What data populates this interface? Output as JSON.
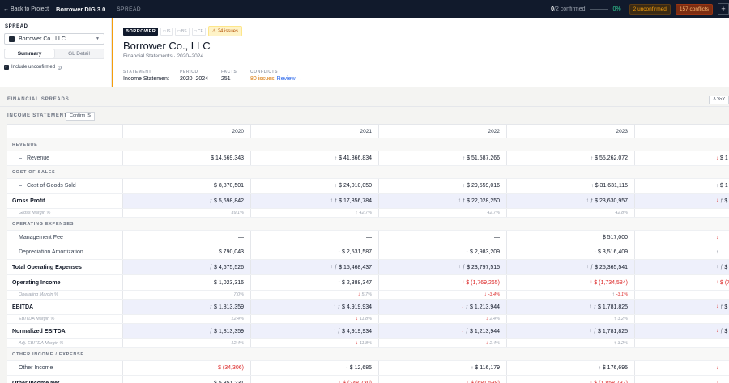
{
  "topbar": {
    "back_label": "← Back to Project",
    "app_title": "Borrower DIG 3.0",
    "tab_label": "SPREAD",
    "confirmed_count": "0",
    "confirmed_text": "/2 confirmed",
    "progress_value": 0,
    "progress_pct": "0%",
    "unconfirmed_badge": "2 unconfirmed",
    "conflicts_badge": "157 conflicts",
    "plus_icon": "+"
  },
  "sidebar": {
    "section_label": "SPREAD",
    "borrower_select": "Borrower Co., LLC",
    "view_tabs": [
      {
        "label": "Summary",
        "active": true
      },
      {
        "label": "GL Detail",
        "active": false
      }
    ],
    "include_unconfirmed_label": "Include unconfirmed",
    "include_unconfirmed_checked": true
  },
  "header": {
    "badge": "BORROWER",
    "statement_chips": [
      "□ IS",
      "□ BS",
      "□ CF"
    ],
    "issues_chip": "⚠ 24 issues",
    "company_name": "Borrower Co., LLC",
    "subtitle": "Financial Statements · 2020–2024",
    "meta": {
      "statement_label": "STATEMENT",
      "statement_value": "Income Statement",
      "period_label": "PERIOD",
      "period_value": "2020–2024",
      "facts_label": "FACTS",
      "facts_value": "251",
      "conflicts_label": "CONFLICTS",
      "conflicts_value": "80 issues",
      "review_link": "Review →"
    }
  },
  "sections": {
    "financial_spreads": "FINANCIAL SPREADS",
    "yoy_button": "Δ YoY",
    "income_statement": "INCOME STATEMENT",
    "confirm_button": "Confirm IS"
  },
  "table": {
    "columns": [
      "",
      "2020",
      "2021",
      "2022",
      "2023",
      ""
    ],
    "rows": [
      {
        "type": "group",
        "label": "REVENUE"
      },
      {
        "type": "line",
        "indent": true,
        "dot": true,
        "label": "Revenue",
        "cells": [
          {
            "v": "$ 14,569,343"
          },
          {
            "v": "$ 41,866,834",
            "m": "up"
          },
          {
            "v": "$ 51,587,266",
            "m": "up"
          },
          {
            "v": "$ 55,262,072",
            "m": "up"
          },
          {
            "v": "$ 1",
            "m": "dn"
          }
        ]
      },
      {
        "type": "group",
        "label": "COST OF SALES"
      },
      {
        "type": "line",
        "indent": true,
        "dot": true,
        "label": "Cost of Goods Sold",
        "cells": [
          {
            "v": "$ 8,870,501"
          },
          {
            "v": "$ 24,010,050",
            "m": "up"
          },
          {
            "v": "$ 29,559,016",
            "m": "up"
          },
          {
            "v": "$ 31,631,115",
            "m": "up"
          },
          {
            "v": "$ 1",
            "m": "up"
          }
        ]
      },
      {
        "type": "total",
        "shaded": true,
        "label": "Gross Profit",
        "cells": [
          {
            "v": "$ 5,698,842",
            "fx": true
          },
          {
            "v": "$ 17,856,784",
            "m": "up",
            "fx": true
          },
          {
            "v": "$ 22,028,250",
            "m": "up",
            "fx": true
          },
          {
            "v": "$ 23,630,957",
            "m": "up",
            "fx": true
          },
          {
            "v": "$ 1",
            "m": "dn",
            "fx": true
          }
        ]
      },
      {
        "type": "sub",
        "label": "Gross Margin %",
        "cells": [
          {
            "v": "39.1%"
          },
          {
            "v": "42.7%",
            "m": "up"
          },
          {
            "v": "42.7%"
          },
          {
            "v": "42.8%"
          },
          {
            "v": ""
          }
        ]
      },
      {
        "type": "group",
        "label": "OPERATING EXPENSES"
      },
      {
        "type": "line",
        "indent": true,
        "label": "Management Fee",
        "cells": [
          {
            "v": "—"
          },
          {
            "v": "—"
          },
          {
            "v": "—"
          },
          {
            "v": "$ 517,000"
          },
          {
            "v": "",
            "m": "dn"
          }
        ]
      },
      {
        "type": "line",
        "indent": true,
        "label": "Depreciation Amortization",
        "cells": [
          {
            "v": "$ 790,043"
          },
          {
            "v": "$ 2,531,587",
            "m": "up"
          },
          {
            "v": "$ 2,983,209",
            "m": "up"
          },
          {
            "v": "$ 3,516,409",
            "m": "up"
          },
          {
            "v": "",
            "m": "up"
          }
        ]
      },
      {
        "type": "total",
        "shaded": true,
        "label": "Total Operating Expenses",
        "cells": [
          {
            "v": "$ 4,675,526",
            "fx": true
          },
          {
            "v": "$ 15,468,437",
            "m": "up",
            "fx": true
          },
          {
            "v": "$ 23,797,515",
            "m": "up",
            "fx": true
          },
          {
            "v": "$ 25,365,541",
            "m": "up",
            "fx": true
          },
          {
            "v": "$ 2",
            "m": "up",
            "fx": true
          }
        ]
      },
      {
        "type": "total",
        "label": "Operating Income",
        "cells": [
          {
            "v": "$ 1,023,316"
          },
          {
            "v": "$ 2,388,347",
            "m": "up"
          },
          {
            "v": "$ (1,769,265)",
            "m": "dn",
            "neg": true
          },
          {
            "v": "$ (1,734,584)",
            "m": "dn",
            "neg": true
          },
          {
            "v": "$ (7",
            "m": "dn",
            "neg": true
          }
        ]
      },
      {
        "type": "sub",
        "label": "Operating Margin %",
        "cells": [
          {
            "v": "7.0%"
          },
          {
            "v": "5.7%",
            "m": "dn"
          },
          {
            "v": "-3.4%",
            "m": "dn",
            "neg": true
          },
          {
            "v": "-3.1%",
            "m": "up",
            "neg": true
          },
          {
            "v": ""
          }
        ]
      },
      {
        "type": "total",
        "shaded": true,
        "label": "EBITDA",
        "cells": [
          {
            "v": "$ 1,813,359",
            "fx": true
          },
          {
            "v": "$ 4,919,934",
            "m": "up",
            "fx": true
          },
          {
            "v": "$ 1,213,944",
            "m": "dn",
            "fx": true
          },
          {
            "v": "$ 1,781,825",
            "m": "up",
            "fx": true
          },
          {
            "v": "$ 1",
            "m": "dn",
            "fx": true
          }
        ]
      },
      {
        "type": "sub",
        "label": "EBITDA Margin %",
        "cells": [
          {
            "v": "12.4%"
          },
          {
            "v": "11.8%",
            "m": "dn"
          },
          {
            "v": "2.4%",
            "m": "dn"
          },
          {
            "v": "3.2%",
            "m": "up"
          },
          {
            "v": ""
          }
        ]
      },
      {
        "type": "total",
        "shaded": true,
        "label": "Normalized EBITDA",
        "cells": [
          {
            "v": "$ 1,813,359",
            "fx": true
          },
          {
            "v": "$ 4,919,934",
            "m": "up",
            "fx": true
          },
          {
            "v": "$ 1,213,944",
            "m": "dn",
            "fx": true
          },
          {
            "v": "$ 1,781,825",
            "m": "up",
            "fx": true
          },
          {
            "v": "$ 1",
            "m": "dn",
            "fx": true
          }
        ]
      },
      {
        "type": "sub",
        "label": "Adj. EBITDA Margin %",
        "cells": [
          {
            "v": "12.4%"
          },
          {
            "v": "11.8%",
            "m": "dn"
          },
          {
            "v": "2.4%",
            "m": "dn"
          },
          {
            "v": "3.2%",
            "m": "up"
          },
          {
            "v": ""
          }
        ]
      },
      {
        "type": "group",
        "label": "OTHER INCOME / EXPENSE"
      },
      {
        "type": "line",
        "indent": true,
        "label": "Other Income",
        "cells": [
          {
            "v": "$ (34,306)",
            "neg": true
          },
          {
            "v": "$ 12,685",
            "m": "up"
          },
          {
            "v": "$ 116,179",
            "m": "up"
          },
          {
            "v": "$ 176,695",
            "m": "up"
          },
          {
            "v": "",
            "m": "dn"
          }
        ]
      },
      {
        "type": "total",
        "label": "Other Income Net",
        "cells": [
          {
            "v": "$ 5,851,231"
          },
          {
            "v": "$ (248,730)",
            "m": "dn",
            "neg": true
          },
          {
            "v": "$ (681,538)",
            "m": "dn",
            "neg": true
          },
          {
            "v": "$ (1,858,737)",
            "m": "dn",
            "neg": true
          },
          {
            "v": "",
            "m": "dn"
          }
        ]
      }
    ]
  },
  "colors": {
    "accent": "#f59e0b",
    "topbar_bg": "#111a2c",
    "negative": "#dc2626",
    "link": "#2563eb",
    "highlight_row": "#eef0fb"
  },
  "icons": {
    "doc_icon": "doc-icon",
    "chevron": "chevron-down-icon",
    "info": "info-icon",
    "arrow_up": "arrow-up-icon",
    "arrow_down": "arrow-down-icon",
    "formula": "formula-icon"
  }
}
